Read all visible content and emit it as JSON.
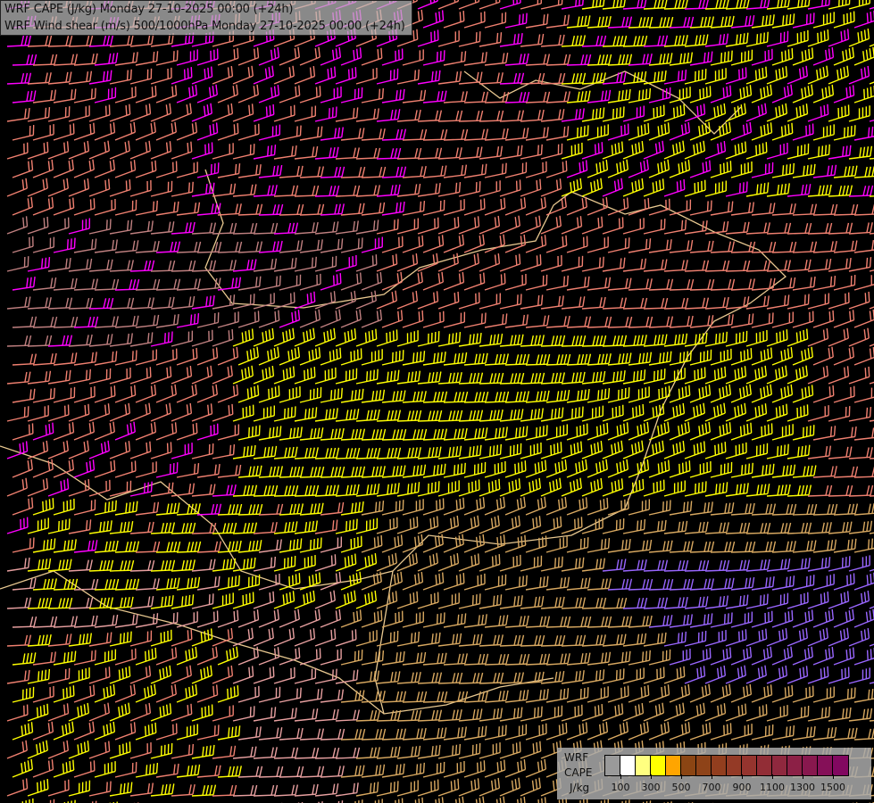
{
  "title": {
    "line1": "WRF CAPE (J/kg) Monday 27-10-2025 00:00 (+24h)",
    "line2": "WRF Wind shear (m/s) 500/1000hPa Monday 27-10-2025 00:00 (+24h)"
  },
  "legend": {
    "label_lines": [
      "WRF",
      "CAPE",
      "J/kg"
    ],
    "tick_labels": [
      "100",
      "300",
      "500",
      "700",
      "900",
      "1100",
      "1300",
      "1500"
    ],
    "colors": [
      "#9a9a9a",
      "#ffffff",
      "#ffff80",
      "#ffff00",
      "#ffa500",
      "#8b4513",
      "#8e4318",
      "#923e1e",
      "#943a26",
      "#95342e",
      "#922d36",
      "#8f283e",
      "#8c2046",
      "#88184e",
      "#851058",
      "#820860"
    ]
  },
  "barb_colors": {
    "low": "#c08080",
    "mid": "#f08070",
    "high": "#ff00ff",
    "very_high": "#ffff00",
    "tan": "#d8a860",
    "purple": "#9966ff",
    "pink": "#e8a0a0"
  }
}
